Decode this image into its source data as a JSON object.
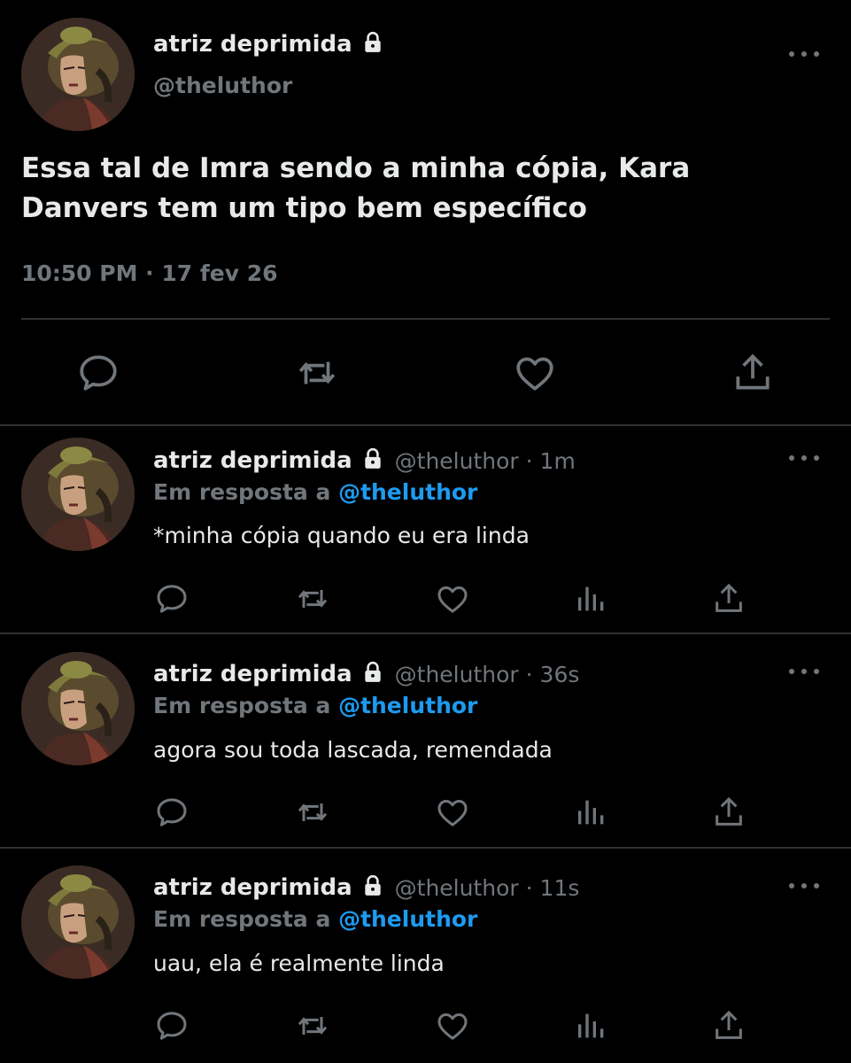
{
  "main_tweet": {
    "name": "atriz deprimida",
    "handle": "@theluthor",
    "text": "Essa tal de Imra sendo a minha cópia, Kara Danvers tem um tipo bem específico",
    "timestamp": "10:50 PM · 17 fev 26",
    "actions": [
      "reply-icon",
      "retweet-icon",
      "like-icon",
      "share-icon"
    ]
  },
  "replies": [
    {
      "name": "atriz deprimida",
      "handle_time": "@theluthor · 1m",
      "reply_prefix": "Em resposta a",
      "reply_to": "@theluthor",
      "text": "*minha cópia quando eu era linda"
    },
    {
      "name": "atriz deprimida",
      "handle_time": "@theluthor · 36s",
      "reply_prefix": "Em resposta a",
      "reply_to": "@theluthor",
      "text": "agora sou toda lascada, remendada"
    },
    {
      "name": "atriz deprimida",
      "handle_time": "@theluthor · 11s",
      "reply_prefix": "Em resposta a",
      "reply_to": "@theluthor",
      "text": "uau, ela é realmente linda"
    }
  ],
  "colors": {
    "background": "#000000",
    "text": "#e7e9ea",
    "muted": "#71767b",
    "link": "#1d9bf0",
    "divider": "#2f3336"
  }
}
